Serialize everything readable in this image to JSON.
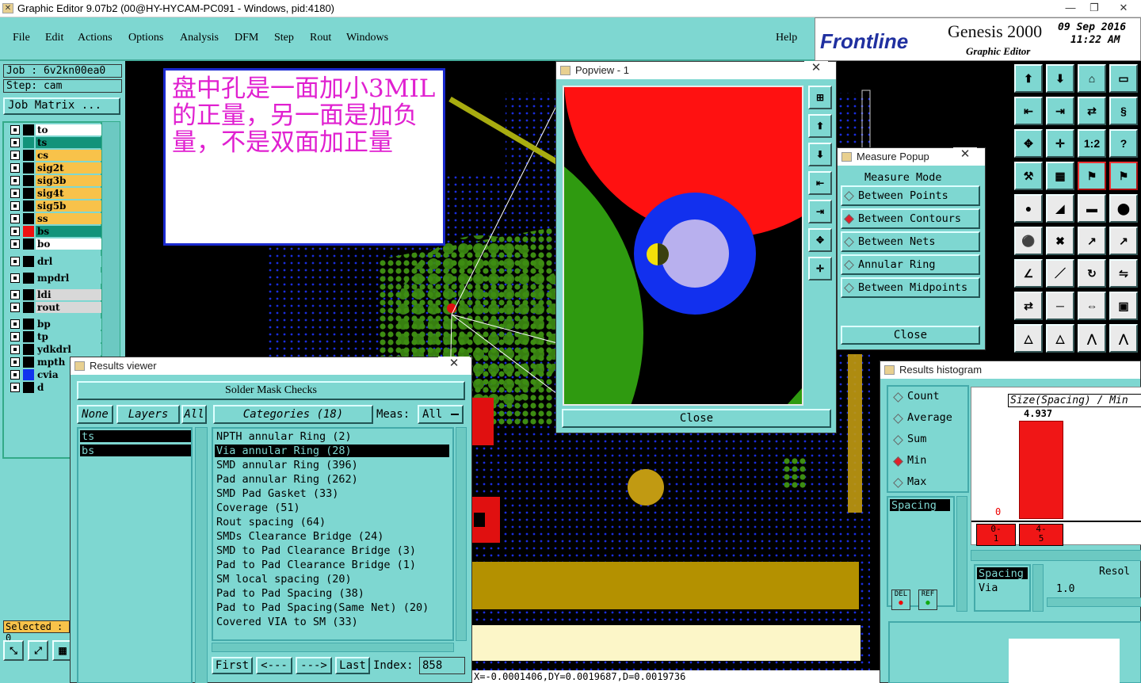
{
  "window": {
    "title": "Graphic Editor 9.07b2 (00@HY-HYCAM-PC091 - Windows, pid:4180)",
    "min": "—",
    "max": "❐",
    "close": "✕"
  },
  "menu": {
    "items": [
      "File",
      "Edit",
      "Actions",
      "Options",
      "Analysis",
      "DFM",
      "Step",
      "Rout",
      "Windows"
    ],
    "help": "Help"
  },
  "brand": {
    "logo": "Frontline",
    "product": "Genesis 2000",
    "subtitle": "Graphic Editor",
    "date": "09 Sep 2016",
    "time": "11:22 AM"
  },
  "left": {
    "job": "Job : 6v2kn00ea0",
    "step": "Step: cam",
    "job_matrix": "Job Matrix ...",
    "selected": "Selected : 0",
    "layers": [
      {
        "name": "to",
        "bg": "#ffffff",
        "color": "#000000"
      },
      {
        "name": "ts",
        "bg": "#12937a",
        "color": "#12937a"
      },
      {
        "name": "cs",
        "bg": "#f8c24a",
        "color": "#000000"
      },
      {
        "name": "sig2t",
        "bg": "#f8c24a",
        "color": "#000000"
      },
      {
        "name": "sig3b",
        "bg": "#f8c24a",
        "color": "#000000"
      },
      {
        "name": "sig4t",
        "bg": "#f8c24a",
        "color": "#000000"
      },
      {
        "name": "sig5b",
        "bg": "#f8c24a",
        "color": "#000000"
      },
      {
        "name": "ss",
        "bg": "#f8c24a",
        "color": "#000000"
      },
      {
        "name": "bs",
        "bg": "#12937a",
        "color": "#ee1111"
      },
      {
        "name": "bo",
        "bg": "#ffffff",
        "color": "#000000"
      },
      {
        "name": "drl",
        "bg": "#7ed7d1",
        "color": "#000000"
      },
      {
        "name": "mpdrl",
        "bg": "#7ed7d1",
        "color": "#000000"
      },
      {
        "name": "ldi",
        "bg": "#d8d8d8",
        "color": "#000000"
      },
      {
        "name": "rout",
        "bg": "#d8d8d8",
        "color": "#000000"
      },
      {
        "name": "bp",
        "bg": "#7ed7d1",
        "color": "#000000"
      },
      {
        "name": "tp",
        "bg": "#7ed7d1",
        "color": "#000000"
      },
      {
        "name": "ydkdrl",
        "bg": "#7ed7d1",
        "color": "#000000"
      },
      {
        "name": "mpth",
        "bg": "#7ed7d1",
        "color": "#000000"
      },
      {
        "name": "cvia",
        "bg": "#7ed7d1",
        "color": "#1133ee"
      },
      {
        "name": "d",
        "bg": "#7ed7d1",
        "color": "#000000"
      }
    ]
  },
  "note": {
    "text": "盘中孔是一面加小3MIL的正量，另一面是加负量，不是双面加正量"
  },
  "popview": {
    "title": "Popview - 1",
    "close": "Close"
  },
  "measure": {
    "title": "Measure Popup",
    "mode_label": "Measure Mode",
    "modes": [
      "Between Points",
      "Between Contours",
      "Between Nets",
      "Annular Ring",
      "Between Midpoints"
    ],
    "selected_mode": 1,
    "close": "Close"
  },
  "results_viewer": {
    "title": "Results viewer",
    "header": "Solder Mask Checks",
    "none": "None",
    "layers_btn": "Layers",
    "all": "All",
    "categories": "Categories (18)",
    "meas_label": "Meas:",
    "meas_value": "All",
    "layers": [
      "ts",
      "bs"
    ],
    "items": [
      "NPTH annular Ring (2)",
      "Via annular Ring (28)",
      "SMD annular Ring (396)",
      "Pad annular Ring (262)",
      "SMD Pad Gasket (33)",
      "Coverage (51)",
      "Rout spacing (64)",
      "SMDs Clearance Bridge (24)",
      "SMD to Pad Clearance Bridge (3)",
      "Pad to Pad Clearance Bridge (1)",
      "SM local spacing (20)",
      "Pad to Pad Spacing (38)",
      "Pad to Pad Spacing(Same Net) (20)",
      "Covered VIA to SM (33)"
    ],
    "selected_item": 1,
    "first": "First",
    "prev": "<---",
    "next": "--->",
    "last": "Last",
    "index_label": "Index:",
    "index_value": "858"
  },
  "histogram": {
    "title": "Results histogram",
    "options": [
      "Count",
      "Average",
      "Sum",
      "Min",
      "Max"
    ],
    "selected_option": 3,
    "list_item": "Spacing",
    "chart_title": "Size(Spacing) / Min",
    "value_label": "4.937",
    "zero": "0",
    "bins": [
      "0-\n1",
      "4-\n5"
    ],
    "sel_item": "Spacing",
    "sel_sub": "Via",
    "resol": "Resol",
    "resol_val": "1.0",
    "del": "DEL",
    "ref": "REF"
  },
  "status": {
    "coords": "X=-0.0001406,DY=0.0019687,D=0.0019736"
  },
  "toolbar": {
    "icons": [
      "top-view-icon",
      "bottom-view-icon",
      "home-icon",
      "window-icon",
      "left-icon",
      "right-icon",
      "swap-icon",
      "mirror-icon",
      "fit-icon",
      "center-icon",
      "ratio-icon",
      "help-icon",
      "tools-icon",
      "grid-icon",
      "snap-icon",
      "snap2-icon",
      "pad-icon",
      "line-icon",
      "ruler-icon",
      "circle-icon",
      "net-icon",
      "cross-icon",
      "measure-icon",
      "measure2-icon",
      "angle-icon",
      "edit-icon",
      "rotate-icon",
      "flip-icon",
      "move-icon",
      "align-icon",
      "resize-icon",
      "layers-icon",
      "triangle-icon",
      "triangle2-icon",
      "arch-icon",
      "arch2-icon"
    ],
    "labels": [
      "⬆",
      "⬇",
      "⌂",
      "▭",
      "⇤",
      "⇥",
      "⇄",
      "§",
      "✥",
      "✛",
      "1:2",
      "?",
      "⚒",
      "▦",
      "⚑",
      "⚑",
      "●",
      "◢",
      "▬",
      "⬤",
      "⚫",
      "✖",
      "↗",
      "↗",
      "∠",
      "／",
      "↻",
      "⇋",
      "⇄",
      "─",
      "⇔",
      "▣",
      "△",
      "△",
      "⋀",
      "⋀"
    ]
  }
}
